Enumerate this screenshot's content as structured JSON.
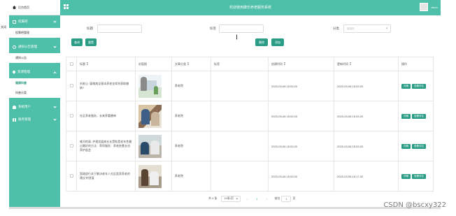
{
  "app": {
    "system_title": "欢迎使用康乐养老服务系统",
    "admin_label": "admin"
  },
  "float_label": "关闭",
  "sidebar": {
    "home_label": "后台首页",
    "groups": [
      {
        "label": "权属吧",
        "icon": "square-icon",
        "items": [
          {
            "label": "权属吧管理"
          }
        ]
      },
      {
        "label": "通知公告管理",
        "icon": "info-icon",
        "items": [
          {
            "label": "通知公告"
          }
        ]
      },
      {
        "label": "资源管理",
        "icon": "pin-icon",
        "items": [
          {
            "label": "健康科普"
          },
          {
            "label": "科普分类"
          }
        ]
      },
      {
        "label": "系统用户",
        "icon": "user-icon",
        "items": []
      },
      {
        "label": "服务管理",
        "icon": "grid-icon",
        "items": []
      }
    ]
  },
  "filters": {
    "title_label": "标题",
    "tag_label": "标签",
    "category_label": "分类",
    "category_placeholder": "请选择"
  },
  "buttons": {
    "search": "查询",
    "reset": "重置",
    "delete": "删除",
    "add": "添加"
  },
  "table": {
    "headers": [
      "标题",
      "封面图",
      "文章分类",
      "标签",
      "创建时间",
      "更新时间",
      "操作"
    ],
    "rows": [
      {
        "title": "刘老让: 疑难病证基本养老金如何获取缴纳?",
        "category": "养老院",
        "tag": "",
        "created": "2023-03-08 15:53:20",
        "updated": "2023-03-08 15:53:20"
      },
      {
        "title": "社区养老服务，长来养看赡神",
        "category": "养老院",
        "tag": "",
        "created": "2023-03-08 15:53:20",
        "updated": "2023-03-08 15:53:20"
      },
      {
        "title": "唯问的高: 护理发展病长长受助是老年性最过最好的方法：养阿服务：养老依靠长也养护起会",
        "category": "养老院",
        "tag": "",
        "created": "2023-03-08 15:53:20",
        "updated": "2023-03-08 15:53:20"
      },
      {
        "title": "国政部行关于解决老年人社区医家养老的建议'的答复",
        "category": "养老院",
        "tag": "",
        "created": "2023-03-08 15:53:20",
        "updated": "2023-03-08 16:17:32"
      }
    ],
    "row_actions": {
      "detail": "详情",
      "comments": "查看评论"
    }
  },
  "pagination": {
    "total": "共 4 条",
    "page_size": "10条/页",
    "prev": "<",
    "current": "1",
    "next": ">",
    "goto_label": "前往",
    "goto_value": "1",
    "page_suffix": "页"
  },
  "watermark": "CSDN @bscxy322",
  "colors": {
    "accent": "#4ebfa8",
    "button": "#2b9c86"
  }
}
